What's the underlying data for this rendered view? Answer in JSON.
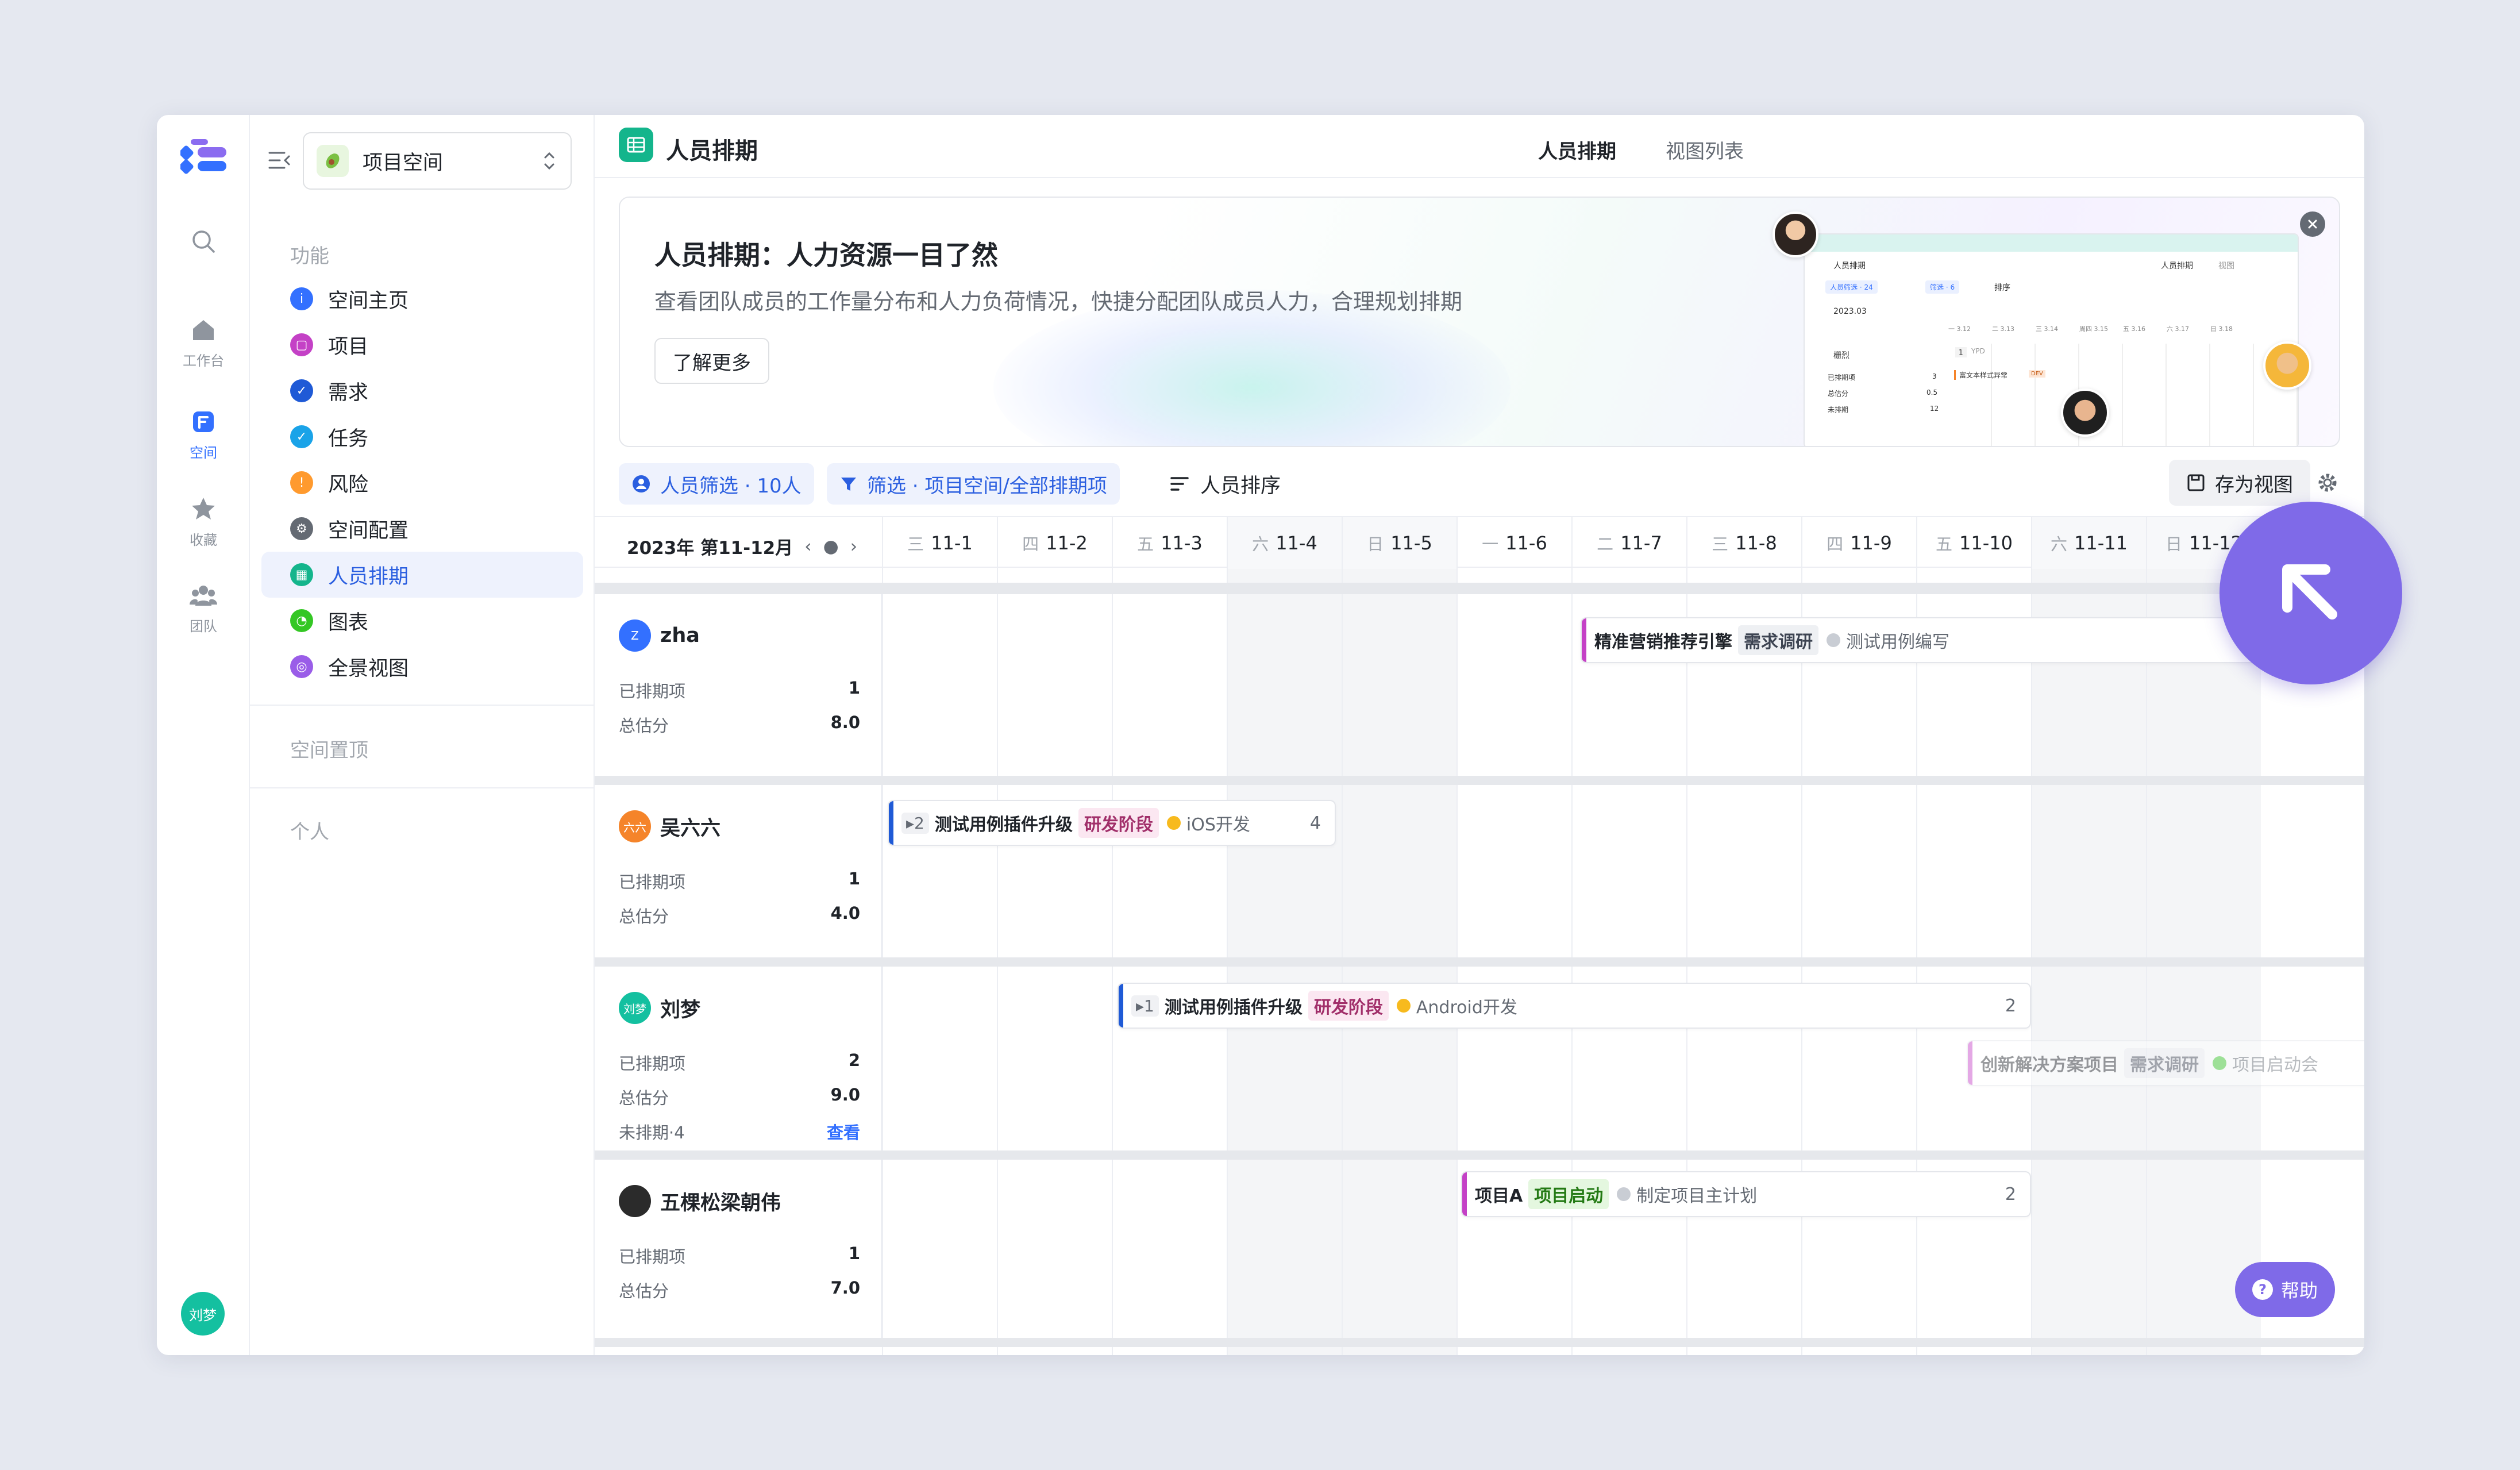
{
  "rail": {
    "items": [
      {
        "label": ""
      },
      {
        "label": "工作台"
      },
      {
        "label": "空间"
      },
      {
        "label": "收藏"
      },
      {
        "label": "团队"
      }
    ],
    "avatar": "刘梦"
  },
  "sidebar": {
    "space_name": "项目空间",
    "section_features": "功能",
    "items": [
      {
        "label": "空间主页",
        "color": "#3370ff"
      },
      {
        "label": "项目",
        "color": "#c441c6"
      },
      {
        "label": "需求",
        "color": "#1f5ad6"
      },
      {
        "label": "任务",
        "color": "#1aa3e8"
      },
      {
        "label": "风险",
        "color": "#ff9a2e"
      },
      {
        "label": "空间配置",
        "color": "#646a73"
      },
      {
        "label": "人员排期",
        "color": "#14b58c"
      },
      {
        "label": "图表",
        "color": "#34c724"
      },
      {
        "label": "全景视图",
        "color": "#9a5de8"
      }
    ],
    "section_pinned": "空间置顶",
    "section_personal": "个人"
  },
  "header": {
    "title": "人员排期",
    "tabs": [
      {
        "label": "人员排期"
      },
      {
        "label": "视图列表"
      }
    ]
  },
  "banner": {
    "title": "人员排期：人力资源一目了然",
    "desc": "查看团队成员的工作量分布和人力负荷情况，快捷分配团队成员人力，合理规划排期",
    "button": "了解更多",
    "preview": {
      "title": "人员排期",
      "tab1": "人员排期",
      "tab2": "视图",
      "chip1": "人员筛选 · 24",
      "chip2": "筛选 · 6",
      "sort": "排序",
      "month": "2023.03",
      "person": "栅烈",
      "stat1": "已排期项",
      "stat1_val": "3",
      "stat2": "总估分",
      "stat2_val": "0.5",
      "stat3": "未排期",
      "stat3_val": "12",
      "bar_num": "1",
      "bar_name": "YPD",
      "bar2": "富文本样式异常",
      "bar2_tag": "DEV",
      "days": [
        "一 3.12",
        "二 3.13",
        "三 3.14",
        "周四 3.15",
        "五 3.16",
        "六 3.17",
        "日 3.18"
      ]
    }
  },
  "toolbar": {
    "member_filter": "人员筛选 · 10人",
    "filter": "筛选 · 项目空间/全部排期项",
    "sort": "人员排序",
    "save_view": "存为视图"
  },
  "timeline": {
    "period": "2023年 第11-12月",
    "days": [
      {
        "wd": "三",
        "date": "11-1",
        "weekend": false
      },
      {
        "wd": "四",
        "date": "11-2",
        "weekend": false
      },
      {
        "wd": "五",
        "date": "11-3",
        "weekend": false
      },
      {
        "wd": "六",
        "date": "11-4",
        "weekend": true
      },
      {
        "wd": "日",
        "date": "11-5",
        "weekend": true
      },
      {
        "wd": "一",
        "date": "11-6",
        "weekend": false
      },
      {
        "wd": "二",
        "date": "11-7",
        "weekend": false
      },
      {
        "wd": "三",
        "date": "11-8",
        "weekend": false
      },
      {
        "wd": "四",
        "date": "11-9",
        "weekend": false
      },
      {
        "wd": "五",
        "date": "11-10",
        "weekend": false
      },
      {
        "wd": "六",
        "date": "11-11",
        "weekend": true
      },
      {
        "wd": "日",
        "date": "11-12",
        "weekend": true
      }
    ]
  },
  "people": [
    {
      "name": "zha",
      "avatar": "Z",
      "avatar_color": "#3370ff",
      "stats": [
        {
          "label": "已排期项",
          "value": "1"
        },
        {
          "label": "总估分",
          "value": "8.0"
        }
      ]
    },
    {
      "name": "吴六六",
      "avatar": "六六",
      "avatar_color": "#f5842a",
      "stats": [
        {
          "label": "已排期项",
          "value": "1"
        },
        {
          "label": "总估分",
          "value": "4.0"
        }
      ]
    },
    {
      "name": "刘梦",
      "avatar": "刘梦",
      "avatar_color": "#14c0a0",
      "stats": [
        {
          "label": "已排期项",
          "value": "2"
        },
        {
          "label": "总估分",
          "value": "9.0"
        },
        {
          "label": "未排期·4",
          "value": "查看"
        }
      ]
    },
    {
      "name": "五棵松梁朝伟",
      "avatar": "",
      "avatar_color": "#2b2b2b",
      "stats": [
        {
          "label": "已排期项",
          "value": "1"
        },
        {
          "label": "总估分",
          "value": "7.0"
        }
      ]
    }
  ],
  "bars": [
    {
      "name": "精准营销推荐引擎",
      "tag": "需求调研",
      "tag_bg": "#eef0f3",
      "tag_fg": "#3d4452",
      "accent": "#c441c6",
      "dot": "#c9cdd4",
      "sub": "测试用例编写",
      "count": "",
      "num": ""
    },
    {
      "name": "测试用例插件升级",
      "tag": "研发阶段",
      "tag_bg": "#fbe7f1",
      "tag_fg": "#a12f6a",
      "accent": "#1f5ad6",
      "dot": "#f7ba1e",
      "sub": "iOS开发",
      "count": "▸2",
      "num": "4"
    },
    {
      "name": "测试用例插件升级",
      "tag": "研发阶段",
      "tag_bg": "#fbe7f1",
      "tag_fg": "#a12f6a",
      "accent": "#1f5ad6",
      "dot": "#f7ba1e",
      "sub": "Android开发",
      "count": "▸1",
      "num": "2"
    },
    {
      "name": "创新解决方案项目",
      "tag": "需求调研",
      "tag_bg": "#eef0f3",
      "tag_fg": "#3d4452",
      "accent": "#c441c6",
      "dot": "#34c724",
      "sub": "项目启动会",
      "count": "",
      "num": ""
    },
    {
      "name": "项目A",
      "tag": "项目启动",
      "tag_bg": "#e4f7df",
      "tag_fg": "#237a14",
      "accent": "#c441c6",
      "dot": "#c9cdd4",
      "sub": "制定项目主计划",
      "count": "",
      "num": "2"
    },
    {
      "name": "项目A",
      "tag": "项",
      "tag_bg": "#e4f7df",
      "tag_fg": "#237a14",
      "accent": "#c441c6",
      "dot": "",
      "sub": "",
      "count": "",
      "num": ""
    }
  ],
  "help": "帮助",
  "icons": {
    "logo": "logo-icon",
    "search": "search-icon",
    "home": "home-icon",
    "space": "space-icon",
    "favorite": "star-icon",
    "team": "team-icon",
    "collapse": "collapse-sidebar-icon",
    "fab": "arrow-up-left-icon",
    "settings": "gear-icon"
  }
}
